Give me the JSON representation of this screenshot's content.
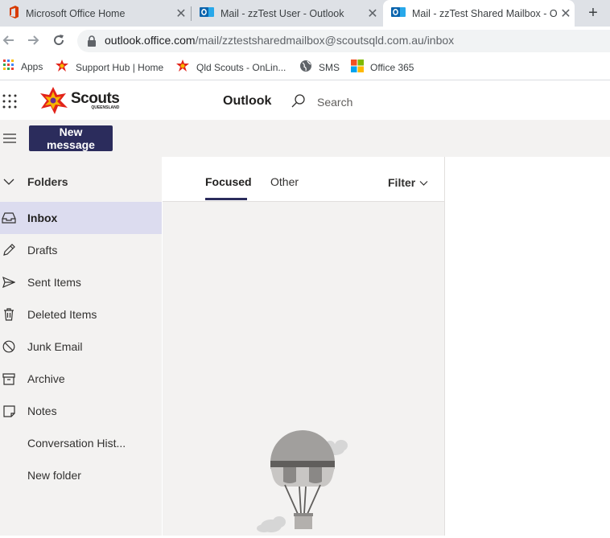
{
  "browser": {
    "tabs": [
      {
        "title": "Microsoft Office Home",
        "icon": "office-icon"
      },
      {
        "title": "Mail - zzTest User - Outlook",
        "icon": "outlook-icon"
      },
      {
        "title": "Mail - zzTest Shared Mailbox - Ou",
        "icon": "outlook-icon"
      }
    ],
    "url_host": "outlook.office.com",
    "url_path": "/mail/zztestsharedmailbox@scoutsqld.com.au/inbox",
    "bookmarks": [
      {
        "label": "Apps",
        "icon": "apps-grid-icon"
      },
      {
        "label": "Support Hub | Home",
        "icon": "scouts-icon"
      },
      {
        "label": "Qld Scouts - OnLin...",
        "icon": "scouts-icon"
      },
      {
        "label": "SMS",
        "icon": "globe-icon"
      },
      {
        "label": "Office 365",
        "icon": "ms-logo-icon"
      }
    ]
  },
  "outlook": {
    "brand": "Scouts",
    "brand_sub": "QUEENSLAND",
    "app_name": "Outlook",
    "search_label": "Search",
    "new_message": "New message",
    "folders_header": "Folders",
    "folders": [
      {
        "label": "Inbox",
        "icon": "inbox-icon"
      },
      {
        "label": "Drafts",
        "icon": "pencil-icon"
      },
      {
        "label": "Sent Items",
        "icon": "send-icon"
      },
      {
        "label": "Deleted Items",
        "icon": "trash-icon"
      },
      {
        "label": "Junk Email",
        "icon": "block-icon"
      },
      {
        "label": "Archive",
        "icon": "archive-icon"
      },
      {
        "label": "Notes",
        "icon": "note-icon"
      },
      {
        "label": "Conversation Hist...",
        "icon": ""
      },
      {
        "label": "New folder",
        "icon": ""
      }
    ],
    "pivots": {
      "focused": "Focused",
      "other": "Other",
      "filter": "Filter"
    },
    "colors": {
      "accent": "#2b2c5c",
      "selected": "#dcdcef"
    }
  }
}
